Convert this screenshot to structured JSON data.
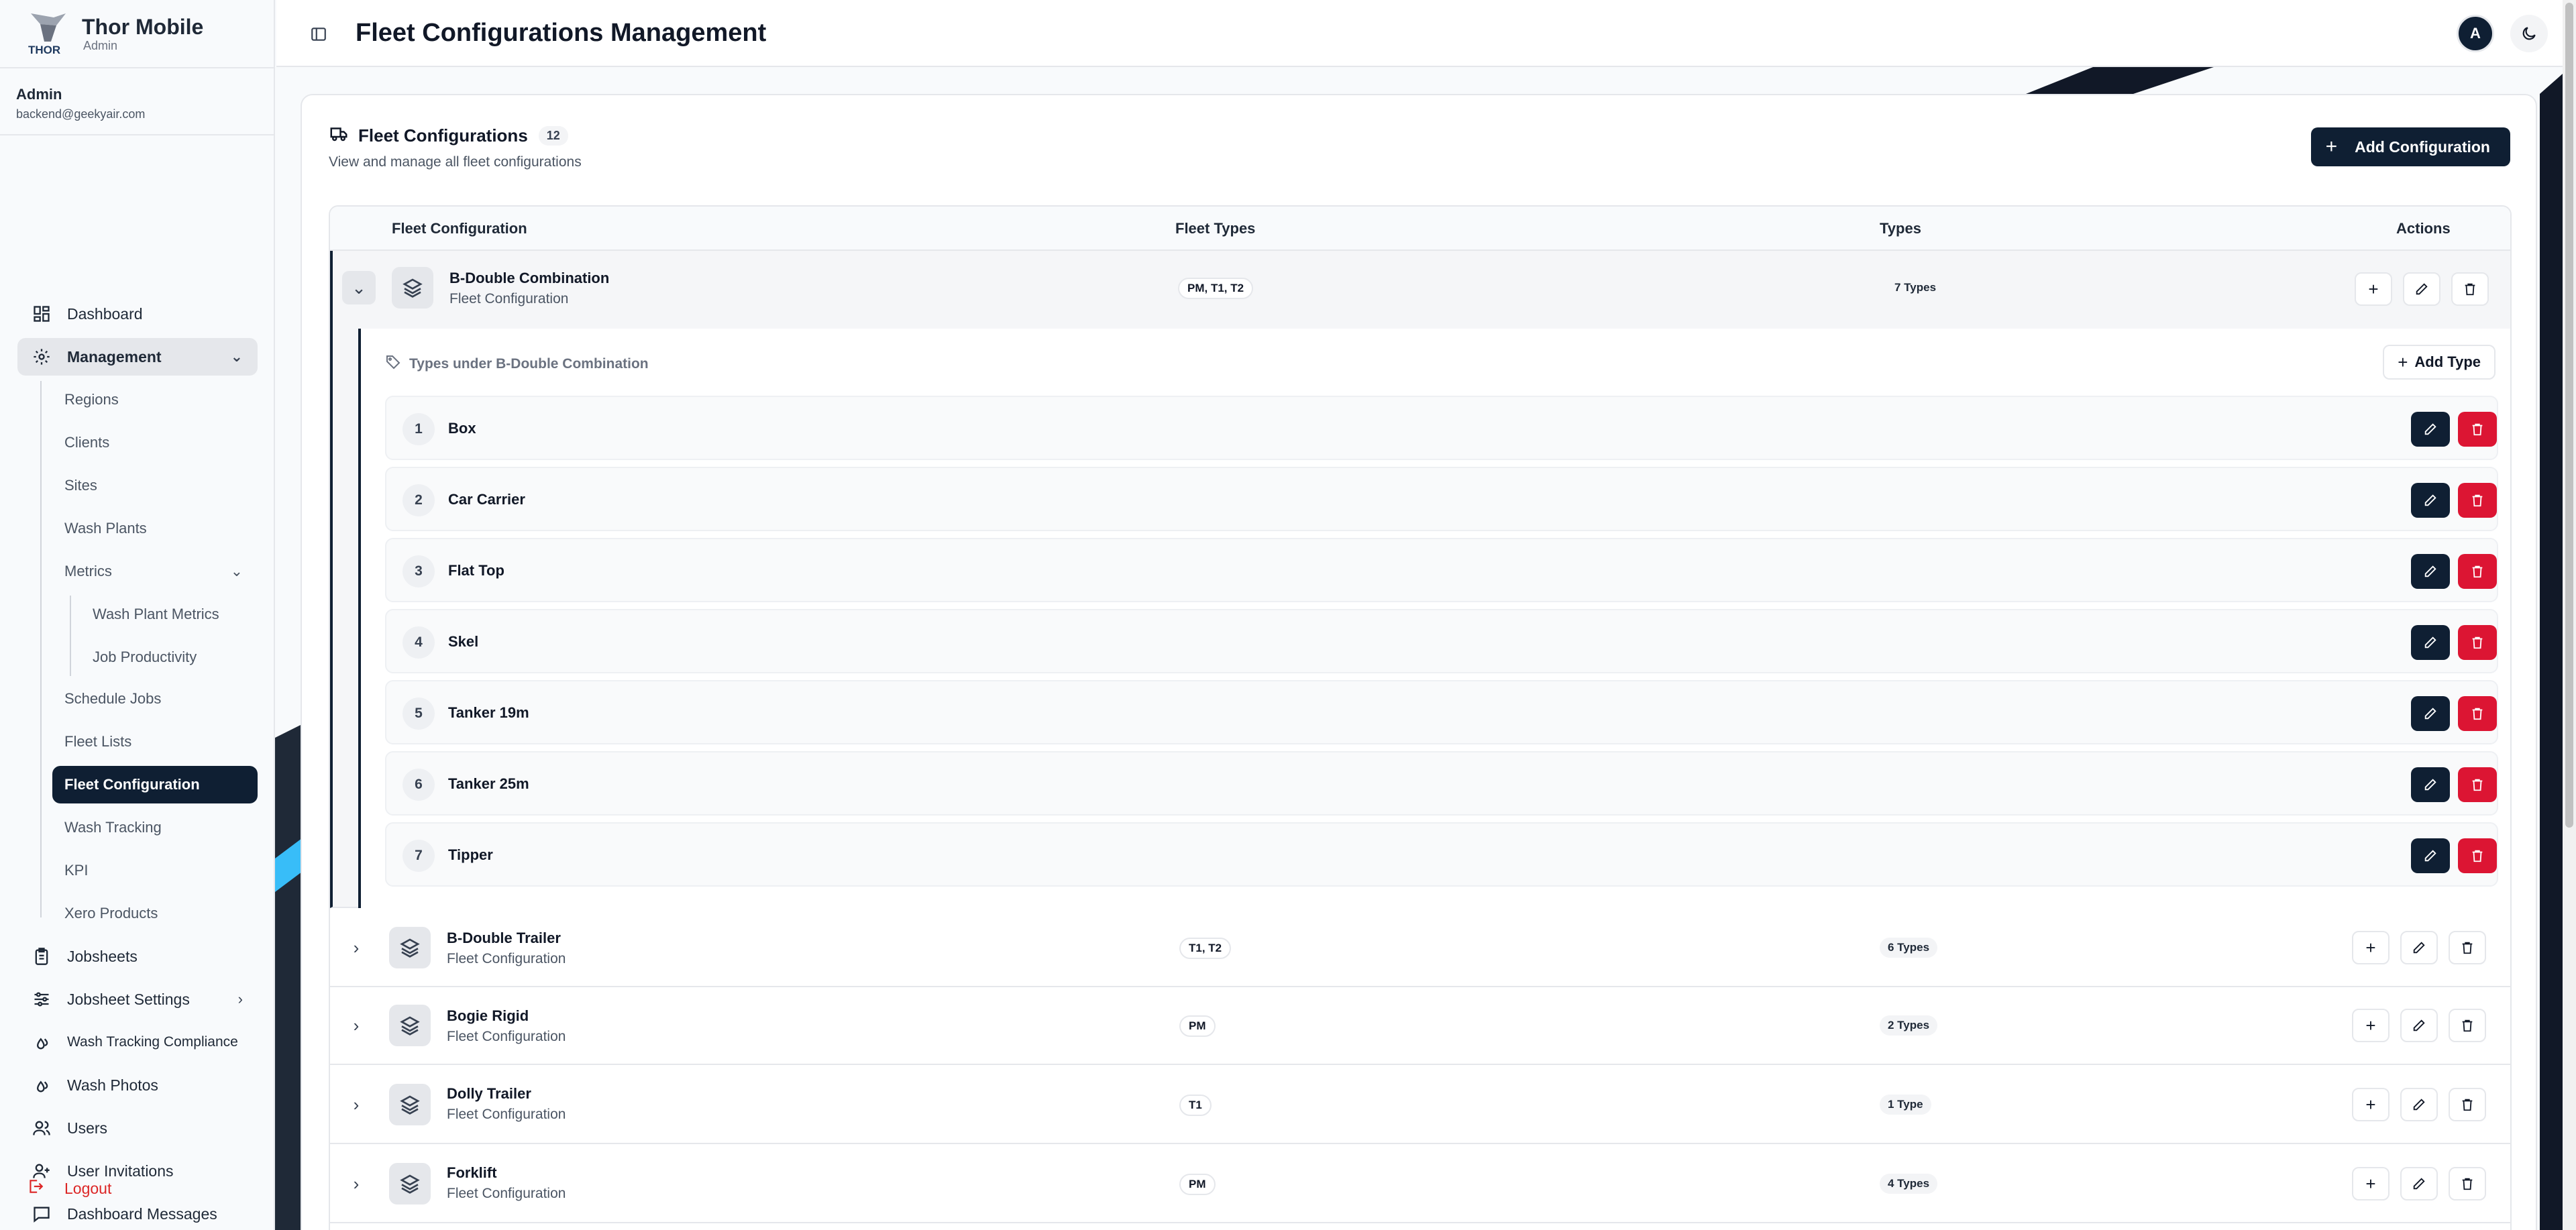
{
  "brand": {
    "title": "Thor Mobile",
    "subtitle": "Admin",
    "logo_text": "THOR"
  },
  "user": {
    "name": "Admin",
    "email": "backend@geekyair.com"
  },
  "sidebar": {
    "dashboard": "Dashboard",
    "management": "Management",
    "management_sub": [
      "Regions",
      "Clients",
      "Sites",
      "Wash Plants",
      "Metrics",
      "Schedule Jobs",
      "Fleet Lists",
      "Fleet Configuration",
      "Wash Tracking",
      "KPI",
      "Xero Products"
    ],
    "metrics_sub": [
      "Wash Plant Metrics",
      "Job Productivity"
    ],
    "jobsheets": "Jobsheets",
    "jobsheet_settings": "Jobsheet Settings",
    "wash_tracking_compliance": "Wash Tracking Compliance",
    "wash_photos": "Wash Photos",
    "users": "Users",
    "user_invitations": "User Invitations",
    "dashboard_messages": "Dashboard Messages",
    "logout": "Logout"
  },
  "header": {
    "title": "Fleet Configurations Management",
    "avatar_initial": "A"
  },
  "card": {
    "title": "Fleet Configurations",
    "count": "12",
    "subtitle": "View and manage all fleet configurations",
    "add_button": "Add Configuration"
  },
  "table": {
    "columns": [
      "Fleet Configuration",
      "Fleet Types",
      "Types",
      "Actions"
    ],
    "rows": [
      {
        "name": "B-Double Combination",
        "sub": "Fleet Configuration",
        "fleet_types": "PM, T1, T2",
        "types": "7 Types"
      },
      {
        "name": "B-Double Trailer",
        "sub": "Fleet Configuration",
        "fleet_types": "T1, T2",
        "types": "6 Types"
      },
      {
        "name": "Bogie Rigid",
        "sub": "Fleet Configuration",
        "fleet_types": "PM",
        "types": "2 Types"
      },
      {
        "name": "Dolly Trailer",
        "sub": "Fleet Configuration",
        "fleet_types": "T1",
        "types": "1 Type"
      },
      {
        "name": "Forklift",
        "sub": "Fleet Configuration",
        "fleet_types": "PM",
        "types": "4 Types"
      }
    ]
  },
  "expanded": {
    "title": "Types under B-Double Combination",
    "add_button": "Add Type",
    "types": [
      {
        "num": "1",
        "name": "Box"
      },
      {
        "num": "2",
        "name": "Car Carrier"
      },
      {
        "num": "3",
        "name": "Flat Top"
      },
      {
        "num": "4",
        "name": "Skel"
      },
      {
        "num": "5",
        "name": "Tanker 19m"
      },
      {
        "num": "6",
        "name": "Tanker 25m"
      },
      {
        "num": "7",
        "name": "Tipper"
      }
    ]
  },
  "colors": {
    "primary": "#0f1f33",
    "danger": "#dc1533",
    "muted": "#6b7280"
  }
}
